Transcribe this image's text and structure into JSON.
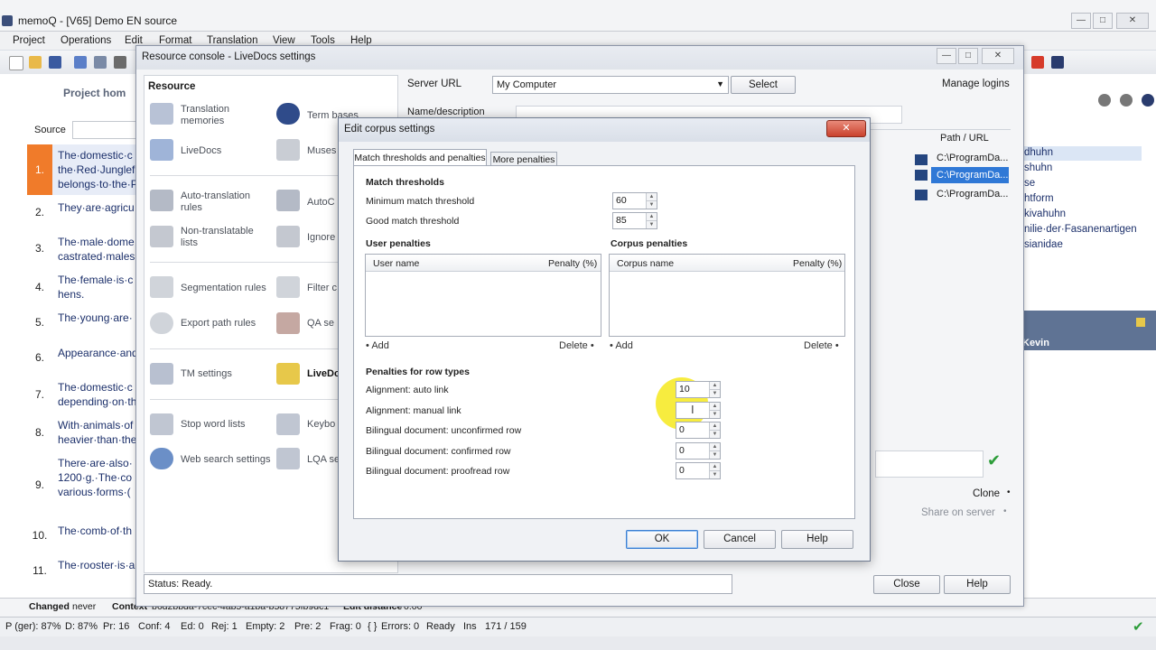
{
  "app": {
    "title": "memoQ - [V65] Demo EN source",
    "menu": [
      "Project",
      "Operations",
      "Edit",
      "Format",
      "Translation",
      "View",
      "Tools",
      "Help"
    ]
  },
  "editor": {
    "project_home": "Project hom",
    "source_label": "Source",
    "rows": [
      {
        "num": "1.",
        "text": "The·domestic·c the·Red·Junglef belongs·to·the·P"
      },
      {
        "num": "2.",
        "text": "They·are·agricu"
      },
      {
        "num": "3.",
        "text": "The·male·dome castrated·males"
      },
      {
        "num": "4.",
        "text": "The·female·is·c hens."
      },
      {
        "num": "5.",
        "text": "The·young·are·"
      },
      {
        "num": "6.",
        "text": "Appearance·and"
      },
      {
        "num": "7.",
        "text": "The·domestic·c depending·on·th"
      },
      {
        "num": "8.",
        "text": "With·animals·of heavier·than·the"
      },
      {
        "num": "9.",
        "text": "There·are·also· 1200·g.·The·co various·forms·("
      },
      {
        "num": "10.",
        "text": "The·comb·of·th"
      },
      {
        "num": "11.",
        "text": "The·rooster·is·a"
      }
    ]
  },
  "right_panel": {
    "items": [
      "dhuhn",
      "shuhn",
      "se",
      "htform",
      "kivahuhn",
      "nilie·der·Fasanenartigen",
      "sianidae"
    ],
    "user": "Kevin"
  },
  "status_bar": {
    "changed_label": "Changed",
    "changed_value": "never",
    "context_label": "Context",
    "context_value": "b6d2bbda-7cec-4ab5-a1ba-b58775fb9dc1",
    "edit_distance_label": "Edit distance",
    "edit_distance_value": "0.00",
    "p": "P (ger): 87%",
    "d": "D: 87%",
    "pr": "Pr: 16",
    "conf": "Conf: 4",
    "ed": "Ed: 0",
    "rej": "Rej: 1",
    "empty": "Empty: 2",
    "pre": "Pre: 2",
    "frag": "Frag: 0",
    "errors": "Errors: 0",
    "ready": "Ready",
    "ins": "Ins",
    "pos": "171 / 159"
  },
  "console": {
    "title": "Resource console - LiveDocs settings",
    "resource_header": "Resource",
    "server_url_label": "Server URL",
    "server_url_value": "My Computer",
    "select_button": "Select",
    "manage_logins": "Manage logins",
    "name_description": "Name/description",
    "path_url_header": "Path / URL",
    "paths": [
      "C:\\ProgramDa...",
      "C:\\ProgramDa...",
      "C:\\ProgramDa..."
    ],
    "resources_left": [
      "Translation memories",
      "LiveDocs",
      "Auto-translation rules",
      "Non-translatable lists",
      "Segmentation rules",
      "Export path rules",
      "TM settings",
      "Stop word lists",
      "Web search settings"
    ],
    "resources_right": [
      "Term bases",
      "Muses",
      "AutoC",
      "Ignore",
      "Filter c",
      "QA se",
      "LiveDo",
      "Keybo",
      "LQA se"
    ],
    "status": "Status: Ready.",
    "clone": "Clone",
    "share_on_server": "Share on server",
    "close_button": "Close",
    "help_button": "Help"
  },
  "dialog": {
    "title": "Edit corpus settings",
    "tabs": [
      "Match thresholds and penalties",
      "More penalties"
    ],
    "match_thresholds_header": "Match thresholds",
    "min_match_label": "Minimum match threshold",
    "min_match_value": "60",
    "good_match_label": "Good match threshold",
    "good_match_value": "85",
    "user_penalties_header": "User penalties",
    "user_name_col": "User name",
    "user_penalty_col": "Penalty (%)",
    "corpus_penalties_header": "Corpus penalties",
    "corpus_name_col": "Corpus name",
    "corpus_penalty_col": "Penalty (%)",
    "add": "Add",
    "delete": "Delete",
    "row_types_header": "Penalties for row types",
    "row_types": [
      {
        "label": "Alignment: auto link",
        "value": "10"
      },
      {
        "label": "Alignment: manual link",
        "value": ""
      },
      {
        "label": "Bilingual document: unconfirmed row",
        "value": "0"
      },
      {
        "label": "Bilingual document: confirmed row",
        "value": "0"
      },
      {
        "label": "Bilingual document: proofread row",
        "value": "0"
      }
    ],
    "ok": "OK",
    "cancel": "Cancel",
    "help": "Help",
    "close_glyph": "✕"
  },
  "colors": {
    "accent_orange": "#f07b2a",
    "selection_blue": "#2f78d6",
    "highlight_yellow": "#f6ea2a",
    "source_text": "#1b2f6a"
  }
}
